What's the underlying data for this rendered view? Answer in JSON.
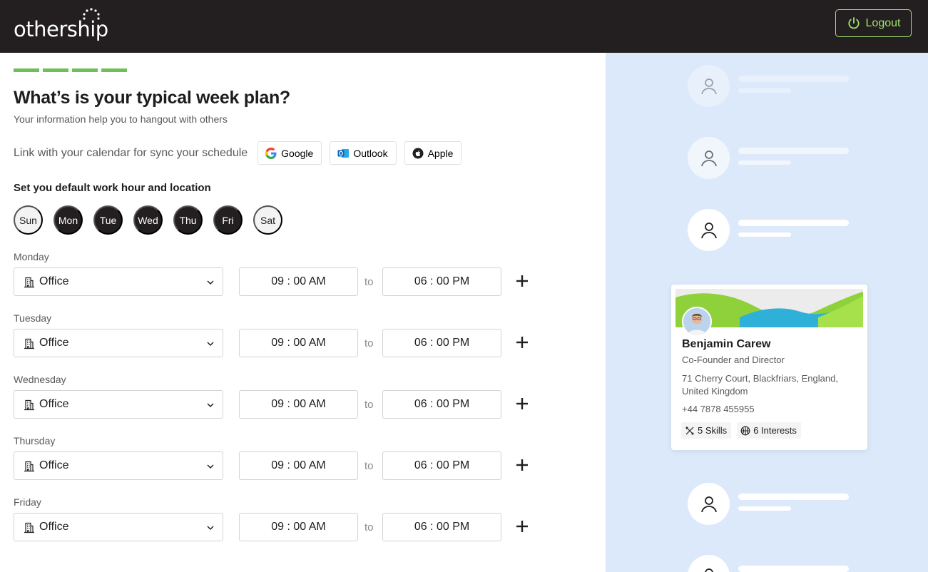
{
  "header": {
    "logo_text": "othership",
    "logout_label": "Logout"
  },
  "progress": {
    "steps_complete": 4,
    "steps_total": 4
  },
  "page": {
    "title": "What’s is your typical week plan?",
    "subtitle": "Your information help you to hangout with others"
  },
  "calendar": {
    "label": "Link with your calendar for sync your schedule",
    "providers": [
      {
        "label": "Google",
        "icon": "google-icon"
      },
      {
        "label": "Outlook",
        "icon": "outlook-icon"
      },
      {
        "label": "Apple",
        "icon": "apple-icon"
      }
    ]
  },
  "work_hours": {
    "title": "Set you default work hour and location",
    "days": [
      {
        "label": "Sun",
        "selected": false
      },
      {
        "label": "Mon",
        "selected": true
      },
      {
        "label": "Tue",
        "selected": true
      },
      {
        "label": "Wed",
        "selected": true
      },
      {
        "label": "Thu",
        "selected": true
      },
      {
        "label": "Fri",
        "selected": true
      },
      {
        "label": "Sat",
        "selected": false
      }
    ],
    "to_label": "to",
    "schedule": [
      {
        "day": "Monday",
        "location": "Office",
        "start": "09 : 00 AM",
        "end": "06 : 00 PM"
      },
      {
        "day": "Tuesday",
        "location": "Office",
        "start": "09 : 00 AM",
        "end": "06 : 00 PM"
      },
      {
        "day": "Wednesday",
        "location": "Office",
        "start": "09 : 00 AM",
        "end": "06 : 00 PM"
      },
      {
        "day": "Thursday",
        "location": "Office",
        "start": "09 : 00 AM",
        "end": "06 : 00 PM"
      },
      {
        "day": "Friday",
        "location": "Office",
        "start": "09 : 00 AM",
        "end": "06 : 00 PM"
      }
    ]
  },
  "profile_card": {
    "name": "Benjamin Carew",
    "role": "Co-Founder and Director",
    "address": "71 Cherry Court, Blackfriars, England, United Kingdom",
    "phone": "+44 7878 455955",
    "skills": "5 Skills",
    "interests": "6 Interests"
  },
  "colors": {
    "header_bg": "#231f20",
    "accent_green": "#9fe36a",
    "progress_green": "#6fbf58",
    "right_panel_bg": "#dce9fb"
  }
}
